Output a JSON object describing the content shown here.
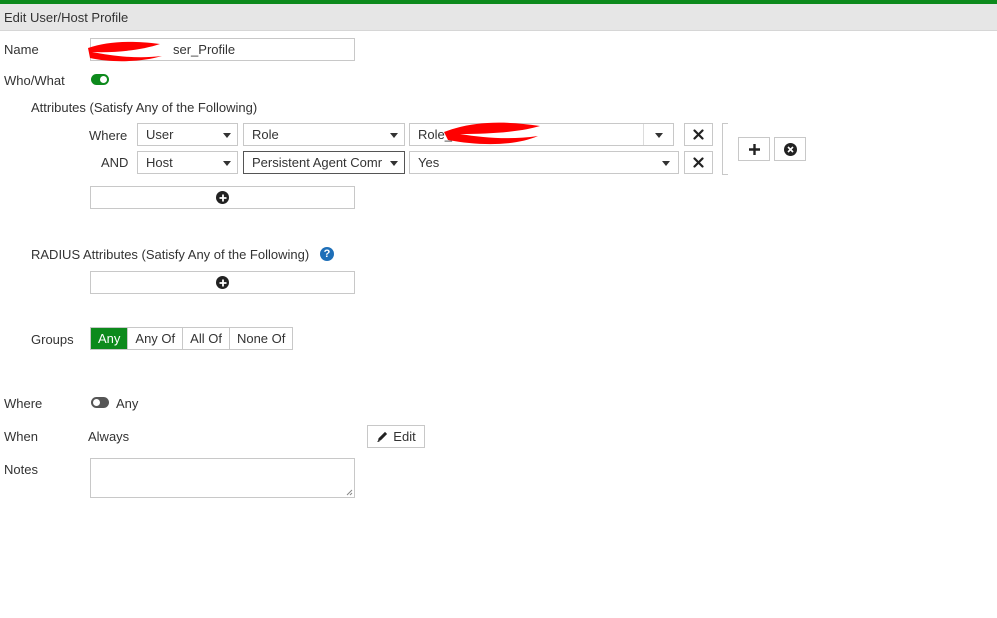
{
  "colors": {
    "accent": "#0d8a1c",
    "toggle_off": "#555555",
    "help": "#1e6fb8",
    "redaction": "#ff0000"
  },
  "dialog": {
    "title": "Edit User/Host Profile"
  },
  "name": {
    "label": "Name",
    "value": "ser_Profile"
  },
  "who_what": {
    "label": "Who/What",
    "enabled": true
  },
  "attributes": {
    "heading": "Attributes (Satisfy Any of the Following)",
    "rows": [
      {
        "connector": "Where",
        "type": "User",
        "attribute": "Role",
        "value": "Role_"
      },
      {
        "connector": "AND",
        "type": "Host",
        "attribute": "Persistent Agent Comr",
        "value": "Yes"
      }
    ],
    "add_icon": "plus-circle-icon"
  },
  "radius": {
    "heading": "RADIUS Attributes (Satisfy Any of the Following)",
    "help_icon": "question-circle-icon"
  },
  "groups": {
    "label": "Groups",
    "options": [
      "Any",
      "Any Of",
      "All Of",
      "None Of"
    ],
    "selected": "Any"
  },
  "where": {
    "label": "Where",
    "enabled": false,
    "value": "Any"
  },
  "when": {
    "label": "When",
    "value": "Always",
    "edit_label": "Edit"
  },
  "notes": {
    "label": "Notes",
    "value": ""
  }
}
